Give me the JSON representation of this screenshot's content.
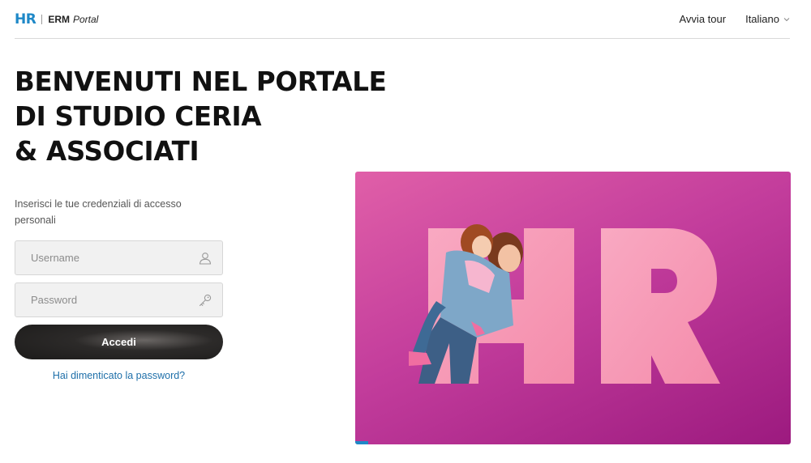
{
  "header": {
    "brand_mark": "HR",
    "brand_name": "ERM",
    "brand_suffix": "Portal",
    "tour_link": "Avvia tour",
    "language": "Italiano"
  },
  "title": {
    "line1": "BENVENUTI NEL PORTALE",
    "line2": "DI STUDIO CERIA",
    "line3": "& ASSOCIATI"
  },
  "login": {
    "intro": "Inserisci le tue credenziali di accesso personali",
    "username_placeholder": "Username",
    "username_value": "",
    "password_placeholder": "Password",
    "password_value": "",
    "submit_label": "Accedi",
    "forgot_label": "Hai dimenticato la password?"
  },
  "hero": {
    "big_text": "HR",
    "carousel_progress": 0.03
  },
  "colors": {
    "brand_blue": "#1e88c7",
    "hero_pink": "#c33d9c",
    "button_dark": "#1c1b1a",
    "link_blue": "#1e6fa9"
  },
  "icons": {
    "username": "user-icon",
    "password": "key-icon",
    "language": "chevron-down-icon"
  }
}
